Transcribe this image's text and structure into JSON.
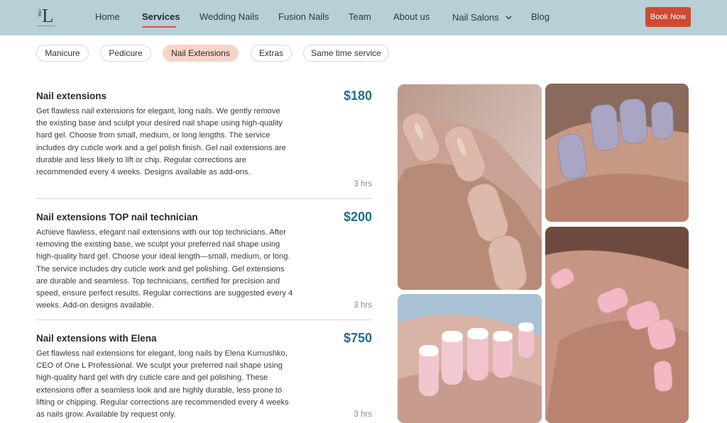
{
  "logo": {
    "one": "ONE",
    "letter": "L"
  },
  "nav": {
    "items": [
      {
        "label": "Home"
      },
      {
        "label": "Services"
      },
      {
        "label": "Wedding Nails"
      },
      {
        "label": "Fusion Nails"
      },
      {
        "label": "Team"
      },
      {
        "label": "About us"
      },
      {
        "label": "Nail Salons"
      },
      {
        "label": "Blog"
      }
    ],
    "active": "Services",
    "book_label": "Book Now"
  },
  "filters": [
    {
      "label": "Manicure"
    },
    {
      "label": "Pedicure"
    },
    {
      "label": "Nail Extensions"
    },
    {
      "label": "Extras"
    },
    {
      "label": "Same time service"
    }
  ],
  "active_filter": "Nail Extensions",
  "services": [
    {
      "title": "Nail extensions",
      "price": "$180",
      "description": "Get flawless nail extensions for elegant, long nails. We gently remove the existing base and sculpt your desired nail shape using high-quality hard gel. Choose from small, medium, or long lengths. The service includes dry cuticle work and a gel polish finish. Gel nail extensions are durable and less likely to lift or chip. Regular corrections are recommended every 4 weeks. Designs available as add-ons.",
      "duration": "3 hrs"
    },
    {
      "title": "Nail extensions TOP nail technician",
      "price": "$200",
      "description": "Achieve flawless, elegant nail extensions with our top technicians. After removing the existing base, we sculpt your preferred nail shape using high-quality hard gel. Choose your ideal length—small, medium, or long. The service includes dry cuticle work and gel polishing. Gel extensions are durable and seamless. Top technicians, certified for precision and speed, ensure perfect results. Regular corrections are suggested every 4 weeks. Add-on designs available.",
      "duration": "3 hrs"
    },
    {
      "title": "Nail extensions with Elena",
      "price": "$750",
      "description": "Get flawless nail extensions for elegant, long nails by Elena Kurnushko, CEO of One L Professional. We sculpt your preferred nail shape using high-quality hard gel with dry cuticle care and gel polishing. These extensions offer a seamless look and are highly durable, less prone to lifting or chipping. Regular corrections are recommended every 4 weeks as nails grow. Available by request only.",
      "duration": "3 hrs"
    }
  ],
  "colors": {
    "header_bg": "#b7cfd6",
    "accent": "#cf4a31",
    "price": "#1f6f8a",
    "active_chip": "#f7d3c8"
  },
  "gallery": [
    {
      "icon": "nude-nails-photo"
    },
    {
      "icon": "lavender-nails-photo"
    },
    {
      "icon": "french-nails-photo"
    },
    {
      "icon": "pink-nails-photo"
    }
  ]
}
